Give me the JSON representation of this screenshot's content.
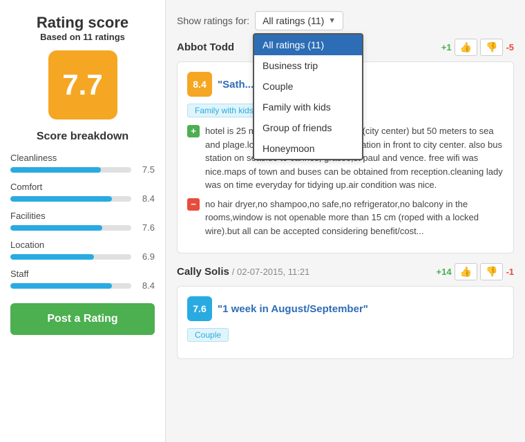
{
  "sidebar": {
    "title": "Rating score",
    "based_on_prefix": "Based on ",
    "rating_count": "11",
    "based_on_suffix": " ratings",
    "score": "7.7",
    "breakdown_title": "Score breakdown",
    "breakdown": [
      {
        "label": "Cleanliness",
        "value": 7.5,
        "display": "7.5",
        "pct": 75
      },
      {
        "label": "Comfort",
        "value": 8.4,
        "display": "8.4",
        "pct": 84
      },
      {
        "label": "Facilities",
        "value": 7.6,
        "display": "7.6",
        "pct": 76
      },
      {
        "label": "Location",
        "value": 6.9,
        "display": "6.9",
        "pct": 69
      },
      {
        "label": "Staff",
        "value": 8.4,
        "display": "8.4",
        "pct": 84
      }
    ],
    "post_rating_label": "Post a Rating"
  },
  "main": {
    "show_ratings_label": "Show ratings for:",
    "dropdown_selected": "All ratings (11)",
    "dropdown_options": [
      {
        "label": "All ratings (11)",
        "active": true
      },
      {
        "label": "Business trip",
        "active": false
      },
      {
        "label": "Couple",
        "active": false
      },
      {
        "label": "Family with kids",
        "active": false
      },
      {
        "label": "Group of friends",
        "active": false
      },
      {
        "label": "Honeymoon",
        "active": false
      }
    ],
    "reviews": [
      {
        "reviewer": "Abbot Todd",
        "date": "",
        "vote_plus": "+1",
        "vote_minus": "-5",
        "score": "8.4",
        "score_color": "orange",
        "title": "\"Sath...",
        "tag": "Family with kids",
        "positive_text": "hotel is 25 minutes walk from massena (city center) but 50 meters to sea and plage.location was fine, also bus station in front to city center. also bus station on seaside to cannes, grasse,st paul and vence. free wifi was nice.maps of town and buses can be obtained from reception.cleaning lady was on time everyday for tidying up.air condition was nice.",
        "negative_text": "no hair dryer,no shampoo,no safe,no refrigerator,no balcony in the rooms,window is not openable more than 15 cm (roped with a locked wire).but all can be accepted considering benefit/cost..."
      },
      {
        "reviewer": "Cally Solis",
        "date": "/ 02-07-2015, 11:21",
        "vote_plus": "+14",
        "vote_minus": "-1",
        "score": "7.6",
        "score_color": "blue",
        "title": "\"1 week in August/September\"",
        "tag": "Couple",
        "positive_text": "",
        "negative_text": ""
      }
    ]
  },
  "icons": {
    "thumb_up": "👍",
    "thumb_down": "👎",
    "plus": "+",
    "minus": "−",
    "dropdown_arrow": "▼"
  }
}
